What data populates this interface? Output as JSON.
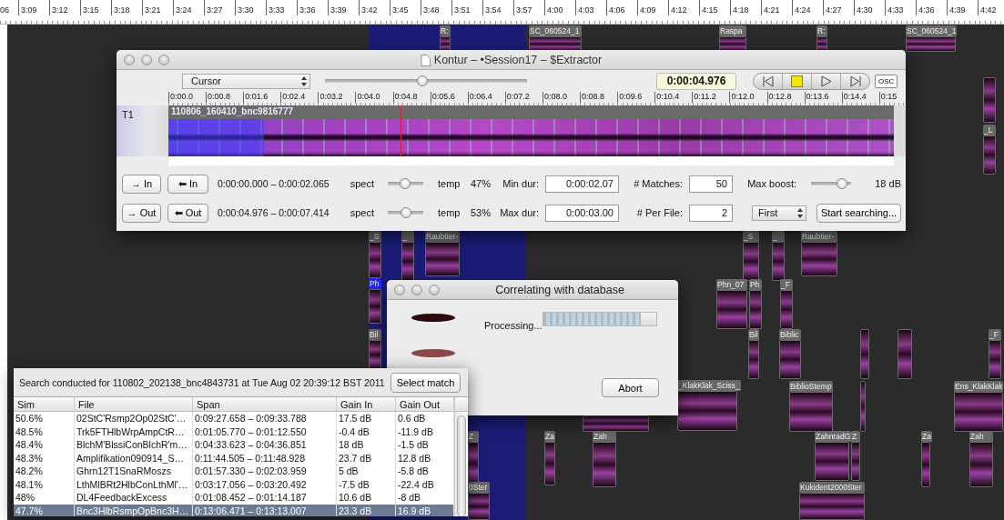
{
  "timeline_ruler": {
    "labels": [
      "06",
      "3:09",
      "3:12",
      "3:15",
      "3:18",
      "3:21",
      "3:24",
      "3:27",
      "3:30",
      "3:33",
      "3:36",
      "3:39",
      "3:42",
      "3:45",
      "3:48",
      "3:51",
      "3:54",
      "3:57",
      "4:00",
      "4:03",
      "4:06",
      "4:09",
      "4:12",
      "4:15",
      "4:18",
      "4:21",
      "4:24",
      "4:27",
      "4:30",
      "4:33",
      "4:36",
      "4:39",
      "4:42"
    ]
  },
  "canvas": {
    "clips": [
      {
        "label": "R:",
        "selected": false
      },
      {
        "label": "SC_060524_1",
        "selected": false
      },
      {
        "label": "Raspa",
        "selected": false
      },
      {
        "label": "R:",
        "selected": false
      },
      {
        "label": "SC_060524_1",
        "selected": false
      },
      {
        "selected": false
      },
      {
        "label": "_L",
        "selected": false
      },
      {
        "label": "_S",
        "selected": false
      },
      {
        "label": "_",
        "selected": false
      },
      {
        "label": "Raubtier-",
        "selected": false
      },
      {
        "label": "_S",
        "selected": false
      },
      {
        "label": "_",
        "selected": false
      },
      {
        "label": "Raubtier-",
        "selected": false
      },
      {
        "label": "Ph",
        "selected": true
      },
      {
        "label": "Phn_07",
        "selected": false
      },
      {
        "label": "Ph",
        "selected": false
      },
      {
        "label": "_F",
        "selected": false
      },
      {
        "label": "Bil",
        "selected": false
      },
      {
        "label": "Bil",
        "selected": false
      },
      {
        "label": "Biblic",
        "selected": false
      },
      {
        "selected": false
      },
      {
        "selected": false
      },
      {
        "label": "_F",
        "selected": false
      },
      {
        "selected": false
      },
      {
        "label": "_KlakKlak_Sciss_",
        "selected": false
      },
      {
        "label": "BiblioStemp",
        "selected": false
      },
      {
        "selected": false
      },
      {
        "label": "Ens_KlakKlak",
        "selected": false
      },
      {
        "label": "Z",
        "selected": false
      },
      {
        "label": "Za",
        "selected": false
      },
      {
        "label": "Zah",
        "selected": false
      },
      {
        "label": "ZahnradG",
        "selected": false
      },
      {
        "label": "Z",
        "selected": false
      },
      {
        "label": "Za",
        "selected": false
      },
      {
        "label": "Zah",
        "selected": false
      },
      {
        "label": "0Ster",
        "selected": false
      },
      {
        "label": "Kukident2000Ster",
        "selected": false
      }
    ]
  },
  "editor_window": {
    "title": "Kontur – •Session17 – $Extractor",
    "mode_popup": "Cursor",
    "zoom_slider": {
      "level": 0.48
    },
    "time_display": "0:00:04.976",
    "transport": [
      {
        "kind": "skip_back"
      },
      {
        "kind": "stop"
      },
      {
        "kind": "play"
      },
      {
        "kind": "skip_forward"
      }
    ],
    "osc_button": "OSC",
    "ruler_labels": [
      "0:00.0",
      "0:00.8",
      "0:01.6",
      "0:02.4",
      "0:03.2",
      "0:04.0",
      "0:04.8",
      "0:05.6",
      "0:06.4",
      "0:07.2",
      "0:08.0",
      "0:08.8",
      "0:09.6",
      "0:10.4",
      "0:11.2",
      "0:12.0",
      "0:12.8",
      "0:13.6",
      "0:14.4",
      "0:15"
    ],
    "track": {
      "name": "T1",
      "region_label": "110806_160410_bnc9816777"
    },
    "rows": [
      {
        "forward_button": "→ In",
        "back_button": "⬅ In",
        "span": "0:00:00.000 – 0:00:02.065",
        "spect_label": "spect",
        "balance": {
          "level": 0.47
        },
        "temp_label": "temp",
        "percent": "47%",
        "dur_label": "Min dur:",
        "dur_value": "0:00:02.07",
        "count_label": "# Matches:",
        "count_value": "50",
        "extra": {
          "kind": "slider",
          "label": "Max boost:",
          "level": 0.88,
          "reading": "18 dB"
        }
      },
      {
        "forward_button": "→ Out",
        "back_button": "⬅ Out",
        "span": "0:00:04.976 – 0:00:07.414",
        "spect_label": "spect",
        "balance": {
          "level": 0.53
        },
        "temp_label": "temp",
        "percent": "53%",
        "dur_label": "Max dur:",
        "dur_value": "0:00:03.00",
        "count_label": "# Per File:",
        "count_value": "2",
        "extra": {
          "kind": "search",
          "popup": "First",
          "button": "Start searching..."
        }
      }
    ]
  },
  "progress_dialog": {
    "title": "Correlating with database",
    "status": "Processing...",
    "progress": {
      "level": 0.86
    },
    "abort_button": "Abort"
  },
  "results": {
    "summary": "Search conducted for 110802_202138_bnc4843731 at Tue Aug 02 20:39:12 BST 2011",
    "select_button": "Select match",
    "columns": [
      "Sim",
      "File",
      "Span",
      "Gain In",
      "Gain Out"
    ],
    "rows": [
      {
        "cells": [
          "50.6%",
          "02StC'Rsmp2Op02StC'…",
          "0:09:27.658 – 0:09:33.788",
          "17.5 dB",
          "0.6 dB"
        ],
        "selected": false
      },
      {
        "cells": [
          "48.5%",
          "Trk5FTHlbWrpAmpCtR…",
          "0:01:05.770 – 0:01:12.550",
          "-0.4 dB",
          "-11.9 dB"
        ],
        "selected": false
      },
      {
        "cells": [
          "48.4%",
          "BlchM'BlssiConBlchR'm…",
          "0:04:33.623 – 0:04:36.851",
          "18 dB",
          "-1.5 dB"
        ],
        "selected": false
      },
      {
        "cells": [
          "48.3%",
          "Amplifikation090914_S…",
          "0:11:44.505 – 0:11:48.928",
          "23.7 dB",
          "12.8 dB"
        ],
        "selected": false
      },
      {
        "cells": [
          "48.2%",
          "Ghrn12T1SnaRMoszs",
          "0:01:57.330 – 0:02:03.959",
          "5 dB",
          "-5.8 dB"
        ],
        "selected": false
      },
      {
        "cells": [
          "48.1%",
          "LthMlBRt2HlbConLthMl'…",
          "0:03:17.056 – 0:03:20.492",
          "-7.5 dB",
          "-22.4 dB"
        ],
        "selected": false
      },
      {
        "cells": [
          "48%",
          "DL4FeedbackExcess",
          "0:01:08.452 – 0:01:14.187",
          "10.6 dB",
          "-8 dB"
        ],
        "selected": false
      },
      {
        "cells": [
          "47.7%",
          "Bnc3HlbRsmpOpBnc3H…",
          "0:13:06.471 – 0:13:13.007",
          "23.3 dB",
          "16.9 dB"
        ],
        "selected": true
      }
    ]
  }
}
